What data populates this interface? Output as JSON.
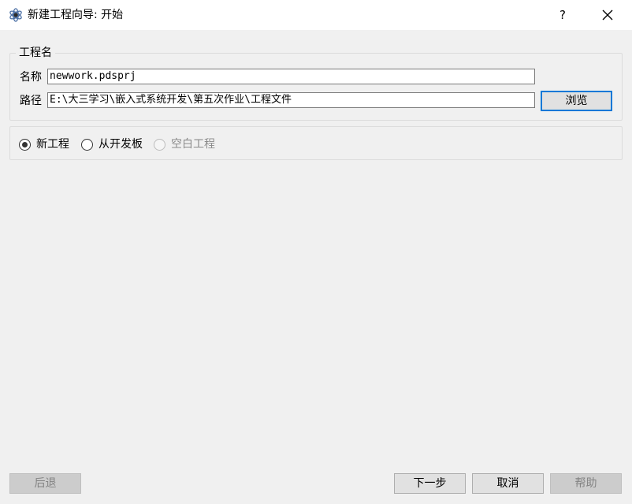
{
  "window": {
    "title": "新建工程向导: 开始",
    "help_label": "?"
  },
  "project_group": {
    "title": "工程名",
    "name_label": "名称",
    "name_value": "newwork.pdsprj",
    "path_label": "路径",
    "path_value": "E:\\大三学习\\嵌入式系统开发\\第五次作业\\工程文件",
    "browse_label": "浏览"
  },
  "project_type": {
    "options": [
      {
        "label": "新工程",
        "checked": true,
        "enabled": true
      },
      {
        "label": "从开发板",
        "checked": false,
        "enabled": true
      },
      {
        "label": "空白工程",
        "checked": false,
        "enabled": false
      }
    ]
  },
  "footer": {
    "back_label": "后退",
    "next_label": "下一步",
    "cancel_label": "取消",
    "help_label": "帮助"
  }
}
